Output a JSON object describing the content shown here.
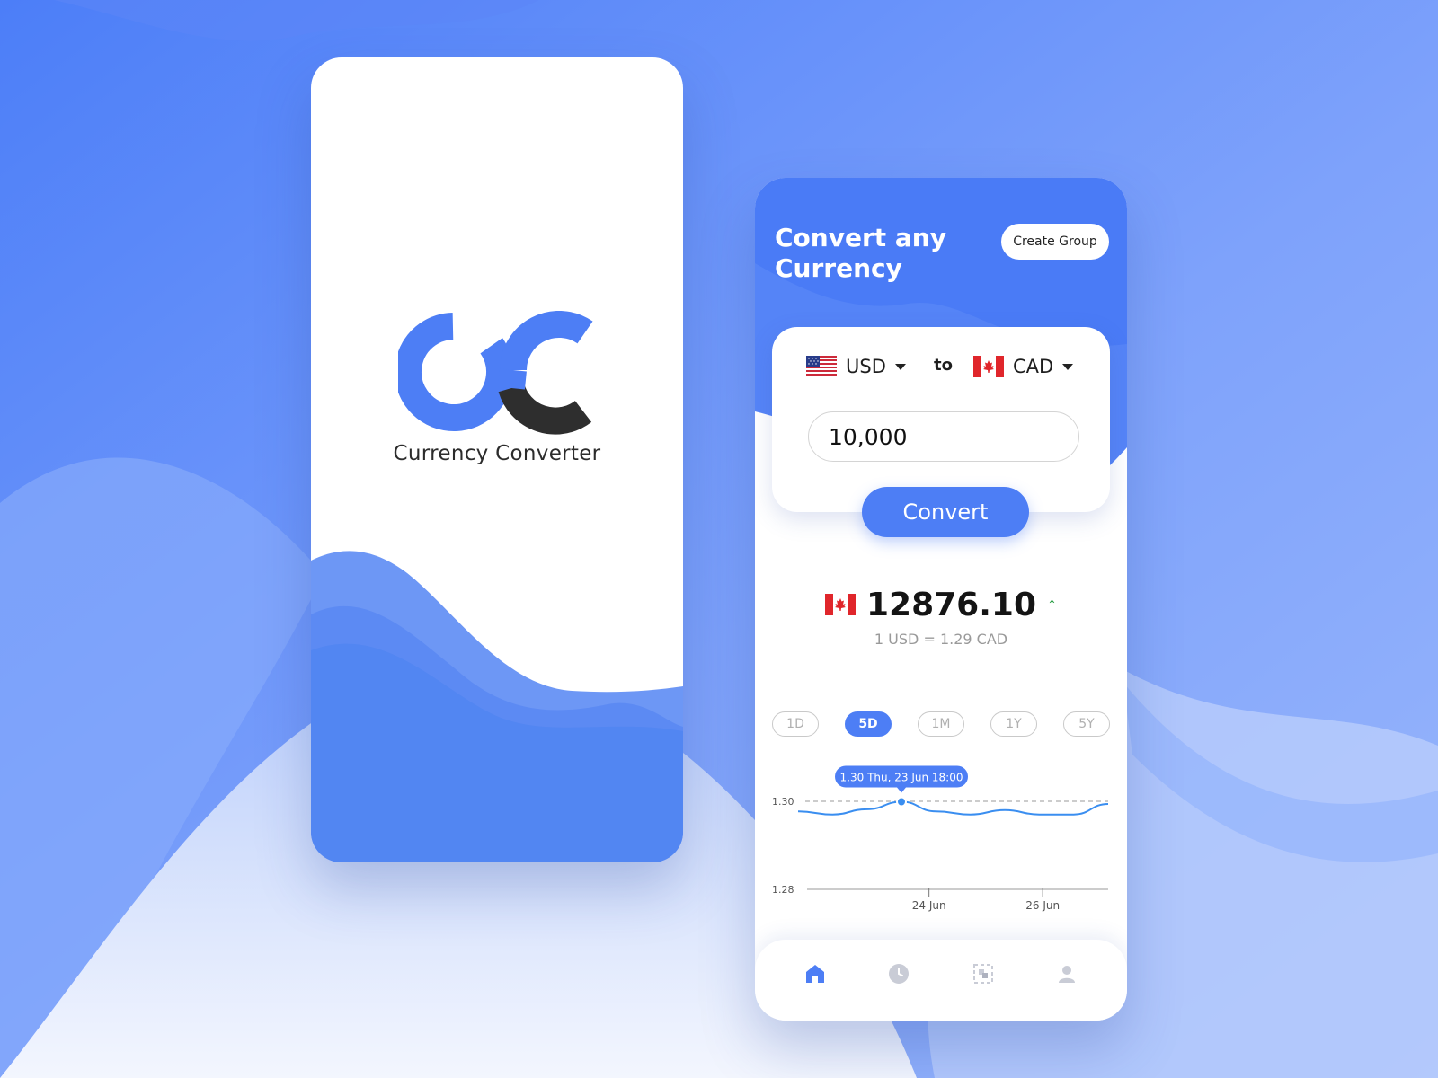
{
  "splash": {
    "logo_name": "Currency Converter"
  },
  "header": {
    "title": "Convert any Currency",
    "create_group_label": "Create Group"
  },
  "converter": {
    "from_currency": "USD",
    "to_label": "to",
    "to_currency": "CAD",
    "amount": "10,000",
    "convert_label": "Convert"
  },
  "result": {
    "value": "12876.10",
    "trend": "up",
    "rate": "1 USD = 1.29 CAD"
  },
  "ranges": [
    {
      "label": "1D",
      "active": false
    },
    {
      "label": "5D",
      "active": true
    },
    {
      "label": "1M",
      "active": false
    },
    {
      "label": "1Y",
      "active": false
    },
    {
      "label": "5Y",
      "active": false
    }
  ],
  "chart_data": {
    "type": "line",
    "x_ticks": [
      "24 Jun",
      "26 Jun"
    ],
    "y_ticks": [
      "1.30",
      "1.28"
    ],
    "ylim": [
      1.28,
      1.3
    ],
    "series": [
      {
        "values": [
          1.2977,
          1.297,
          1.2982,
          1.2999,
          1.2977,
          1.297,
          1.298,
          1.297,
          1.297,
          1.2994
        ]
      }
    ],
    "reference_line": 1.3,
    "tooltip": "1.30 Thu, 23 Jun 18:00",
    "highlight_index": 3
  },
  "nav": {
    "items": [
      "home-icon",
      "clock-icon",
      "scan-icon",
      "profile-icon"
    ],
    "active": "home-icon"
  },
  "colors": {
    "accent": "#4d7ef5",
    "background": "#6f98fb",
    "trend_up": "#1f9a3c",
    "logo_dark": "#2e2e2e"
  }
}
